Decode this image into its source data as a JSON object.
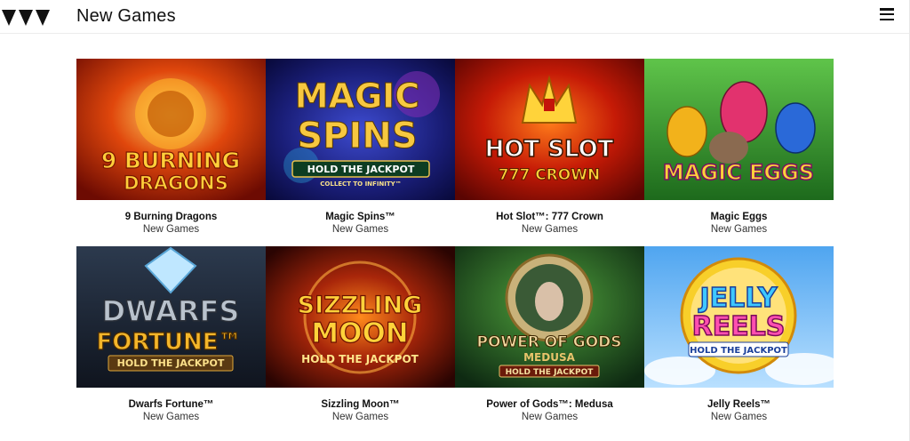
{
  "header": {
    "title": "New Games",
    "logo_icon": "brand-logo-icon",
    "menu_icon": "hamburger-menu-icon"
  },
  "games": [
    {
      "title": "9 Burning Dragons",
      "category": "New Games",
      "art_lines": [
        "9 BURNING",
        "DRAGONS"
      ],
      "theme": [
        "#b81d05",
        "#f7a21b"
      ]
    },
    {
      "title": "Magic Spins™",
      "category": "New Games",
      "art_lines": [
        "MAGIC",
        "SPINS",
        "HOLD THE JACKPOT",
        "COLLECT TO INFINITY™"
      ],
      "theme": [
        "#12175a",
        "#f3c53b"
      ]
    },
    {
      "title": "Hot Slot™: 777 Crown",
      "category": "New Games",
      "art_lines": [
        "HOT SLOT",
        "777 CROWN"
      ],
      "theme": [
        "#9c0b04",
        "#ffd33a"
      ]
    },
    {
      "title": "Magic Eggs",
      "category": "New Games",
      "art_lines": [
        "MAGIC EGGS"
      ],
      "theme": [
        "#2f8f2a",
        "#f6c21a"
      ]
    },
    {
      "title": "Dwarfs Fortune™",
      "category": "New Games",
      "art_lines": [
        "DWARFS",
        "FORTUNE™",
        "HOLD THE JACKPOT"
      ],
      "theme": [
        "#1c2433",
        "#f4b62a"
      ]
    },
    {
      "title": "Sizzling Moon™",
      "category": "New Games",
      "art_lines": [
        "SIZZLING",
        "MOON",
        "HOLD THE JACKPOT"
      ],
      "theme": [
        "#5a0a06",
        "#ff9a1c"
      ]
    },
    {
      "title": "Power of Gods™: Medusa",
      "category": "New Games",
      "art_lines": [
        "POWER OF GODS",
        "MEDUSA",
        "HOLD THE JACKPOT"
      ],
      "theme": [
        "#1d4d22",
        "#e8c36b"
      ]
    },
    {
      "title": "Jelly Reels™",
      "category": "New Games",
      "art_lines": [
        "JELLY",
        "REELS",
        "HOLD THE JACKPOT"
      ],
      "theme": [
        "#3d8fe3",
        "#f8cf2a"
      ]
    }
  ]
}
